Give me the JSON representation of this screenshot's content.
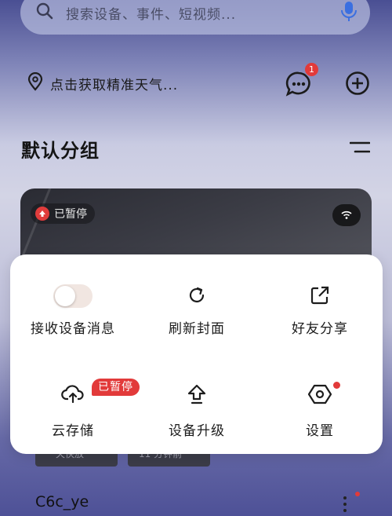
{
  "search": {
    "placeholder": "搜索设备、事件、短视频..."
  },
  "location": {
    "label": "点击获取精准天气..."
  },
  "header": {
    "message_badge": "1"
  },
  "group": {
    "title": "默认分组"
  },
  "camera": {
    "status": "已暂停"
  },
  "thumbnails": [
    "一天快放",
    "11 分钟前"
  ],
  "device": {
    "name": "C6c_ye"
  },
  "menu": {
    "receive_messages": {
      "label": "接收设备消息",
      "enabled": false
    },
    "refresh_cover": {
      "label": "刷新封面"
    },
    "share": {
      "label": "好友分享"
    },
    "cloud_storage": {
      "label": "云存储",
      "badge": "已暂停"
    },
    "upgrade": {
      "label": "设备升级"
    },
    "settings": {
      "label": "设置",
      "has_dot": true
    }
  },
  "colors": {
    "accent_red": "#e23a3a",
    "mic_blue": "#3b6fe0"
  }
}
